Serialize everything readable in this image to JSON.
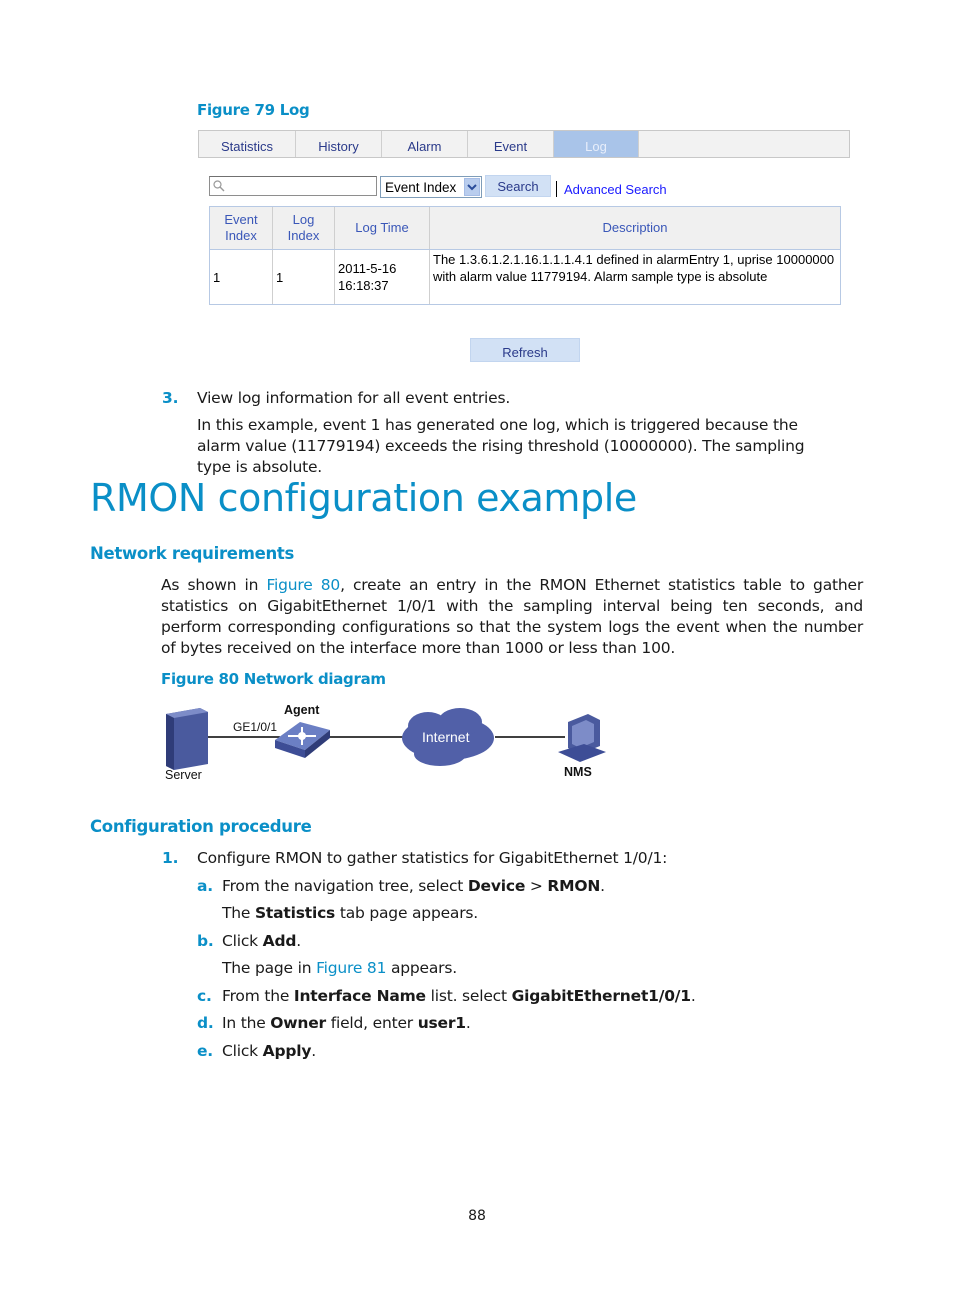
{
  "figure79": {
    "caption": "Figure 79 Log",
    "tabs": [
      {
        "label": "Statistics",
        "active": false
      },
      {
        "label": "History",
        "active": false
      },
      {
        "label": "Alarm",
        "active": false
      },
      {
        "label": "Event",
        "active": false
      },
      {
        "label": "Log",
        "active": true
      }
    ],
    "search": {
      "placeholder": "",
      "value": "",
      "field_selected": "Event Index",
      "search_label": "Search",
      "advanced_label": "Advanced Search"
    },
    "table": {
      "columns": [
        "Event Index",
        "Log Index",
        "Log Time",
        "Description"
      ],
      "rows": [
        {
          "event_index": "1",
          "log_index": "1",
          "log_time": "2011-5-16 16:18:37",
          "description": "The 1.3.6.1.2.1.16.1.1.1.4.1 defined in alarmEntry 1, uprise 10000000 with alarm value 11779194. Alarm sample type is absolute"
        }
      ]
    },
    "refresh_label": "Refresh"
  },
  "step3": {
    "number": "3.",
    "text": "View log information for all event entries.",
    "detail": "In this example, event 1 has generated one log, which is triggered because the alarm value (11779194) exceeds the rising threshold (10000000). The sampling type is absolute."
  },
  "section": {
    "title": "RMON configuration example",
    "network_requirements": {
      "heading": "Network requirements",
      "para_pre": "As shown in ",
      "para_link": "Figure 80",
      "para_post": ", create an entry in the RMON Ethernet statistics table to gather statistics on GigabitEthernet 1/0/1 with the sampling interval being ten seconds, and perform corresponding configurations so that the system logs the event when the number of bytes received on the interface more than 1000 or less than 100."
    },
    "figure80": {
      "caption": "Figure 80 Network diagram",
      "labels": {
        "server": "Server",
        "agent": "Agent",
        "port": "GE1/0/1",
        "internet": "Internet",
        "nms": "NMS"
      }
    },
    "procedure": {
      "heading": "Configuration procedure",
      "step1": {
        "number": "1.",
        "text": "Configure RMON to gather statistics for GigabitEthernet 1/0/1:"
      },
      "substeps": {
        "a": {
          "letter": "a.",
          "t1": "From the navigation tree, select ",
          "b1": "Device",
          "t2": " > ",
          "b2": "RMON",
          "t3": ".",
          "note_pre": "The ",
          "note_bold": "Statistics",
          "note_post": " tab page appears."
        },
        "b": {
          "letter": "b.",
          "t1": "Click ",
          "b1": "Add",
          "t2": ".",
          "note_pre": "The page in ",
          "note_link": "Figure 81",
          "note_post": " appears."
        },
        "c": {
          "letter": "c.",
          "t1": "From the ",
          "b1": "Interface Name",
          "t2": " list. select ",
          "b2": "GigabitEthernet1/0/1",
          "t3": "."
        },
        "d": {
          "letter": "d.",
          "t1": "In the ",
          "b1": "Owner",
          "t2": " field, enter ",
          "b2": "user1",
          "t3": "."
        },
        "e": {
          "letter": "e.",
          "t1": "Click ",
          "b1": "Apply",
          "t2": "."
        }
      }
    }
  },
  "page_number": "88"
}
